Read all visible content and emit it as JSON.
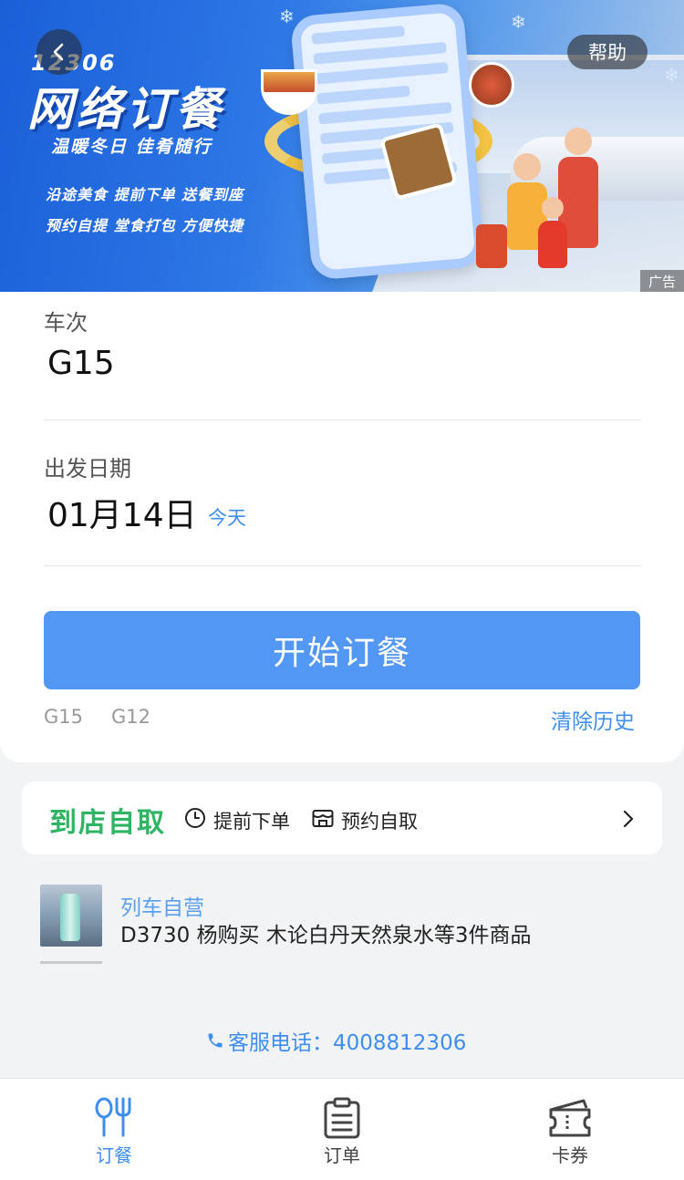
{
  "banner": {
    "logo": "12306",
    "title": "网络订餐",
    "subtitle": "温暖冬日 佳肴随行",
    "line1": "沿途美食 提前下单 送餐到座",
    "line2": "预约自提 堂食打包 方便快捷",
    "ad_label": "广告"
  },
  "header": {
    "back_icon": "chevron-left-icon",
    "help_label": "帮助"
  },
  "form": {
    "train_label": "车次",
    "train_value": "G15",
    "date_label": "出发日期",
    "date_value": "01月14日",
    "date_hint": "今天",
    "start_button": "开始订餐",
    "history": [
      "G15",
      "G12"
    ],
    "clear_history": "清除历史"
  },
  "pickup": {
    "title": "到店自取",
    "tags": [
      "提前下单",
      "预约自取"
    ],
    "icons": [
      "clock-icon",
      "store-icon",
      "chevron-right-icon"
    ]
  },
  "order": {
    "type": "列车自营",
    "description": "D3730 杨购买 木论白丹天然泉水等3件商品"
  },
  "service": {
    "label": "客服电话：4008812306",
    "icon": "phone-icon"
  },
  "tabbar": {
    "items": [
      {
        "label": "订餐",
        "icon": "fork-spoon-icon",
        "active": true
      },
      {
        "label": "订单",
        "icon": "clipboard-icon",
        "active": false
      },
      {
        "label": "卡券",
        "icon": "ticket-icon",
        "active": false
      }
    ]
  },
  "colors": {
    "accent": "#3e8ef0",
    "button": "#5197f3",
    "pickup_green": "#2fb463"
  }
}
